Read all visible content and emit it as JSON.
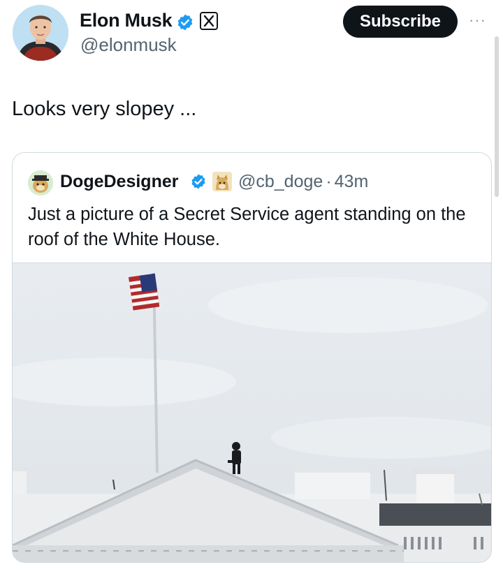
{
  "post": {
    "author_name": "Elon Musk",
    "author_handle": "@elonmusk",
    "subscribe_label": "Subscribe",
    "more_glyph": "···",
    "text": "Looks very slopey ...",
    "avatar_icon": "profile-photo",
    "verified_icon": "verified-badge",
    "affiliation_icon": "x-logo"
  },
  "quote": {
    "author_name": "DogeDesigner",
    "author_handle": "@cb_doge",
    "separator": "·",
    "time": "43m",
    "text": "Just a picture of a Secret Service agent standing on the roof of the White House.",
    "affiliation_icon": "doge-icon"
  },
  "colors": {
    "text_primary": "#0f1419",
    "text_secondary": "#536471",
    "verified_blue": "#1d9bf0",
    "button_black": "#0f1419",
    "border": "#cfd9de"
  }
}
